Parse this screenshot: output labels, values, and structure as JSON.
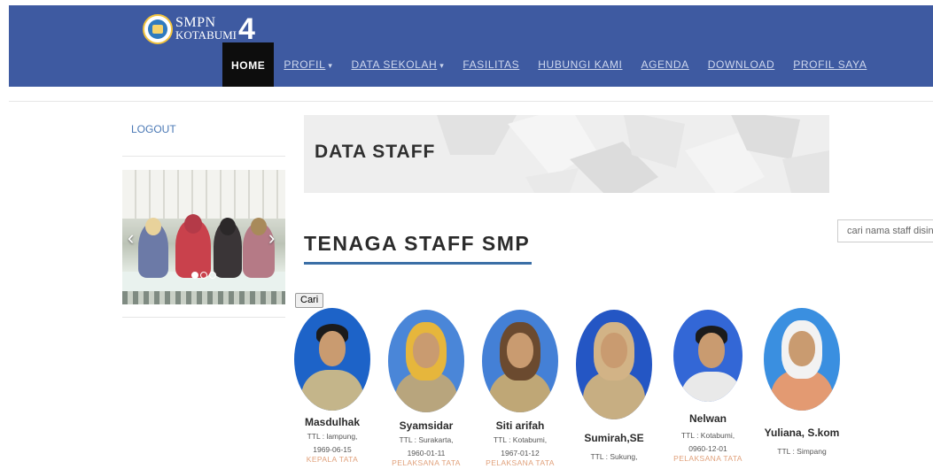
{
  "header": {
    "logo_line1": "SMPN",
    "logo_line2": "KOTABUMI",
    "logo_number": "4",
    "nav": [
      {
        "label": "HOME",
        "active": true,
        "dropdown": false
      },
      {
        "label": "PROFIL",
        "active": false,
        "dropdown": true
      },
      {
        "label": "DATA SEKOLAH",
        "active": false,
        "dropdown": true
      },
      {
        "label": "FASILITAS",
        "active": false,
        "dropdown": false
      },
      {
        "label": "HUBUNGI KAMI",
        "active": false,
        "dropdown": false
      },
      {
        "label": "AGENDA",
        "active": false,
        "dropdown": false
      },
      {
        "label": "DOWNLOAD",
        "active": false,
        "dropdown": false
      },
      {
        "label": "PROFIL SAYA",
        "active": false,
        "dropdown": false
      }
    ],
    "colors": {
      "bar": "#3e5aa1",
      "active": "#0d0d0d"
    }
  },
  "sidebar": {
    "logout_label": "LOGOUT",
    "carousel": {
      "prev_icon": "chevron-left-icon",
      "next_icon": "chevron-right-icon",
      "slides": 3,
      "active_slide": 1
    }
  },
  "main": {
    "banner_title": "DATA STAFF",
    "section_title": "TENAGA STAFF SMP",
    "search": {
      "placeholder": "cari nama staff disini..",
      "button_label": "Cari"
    },
    "accent_color": "#3b6fa6",
    "staff": [
      {
        "name": "Masdulhak",
        "ttl_1": "TTL : lampung,",
        "ttl_2": "1969-06-15",
        "role": "KEPALA TATA"
      },
      {
        "name": "Syamsidar",
        "ttl_1": "TTL : Surakarta,",
        "ttl_2": "1960-01-11",
        "role": "PELAKSANA TATA"
      },
      {
        "name": "Siti arifah",
        "ttl_1": "TTL : Kotabumi,",
        "ttl_2": "1967-01-12",
        "role": "PELAKSANA TATA"
      },
      {
        "name": "Sumirah,SE",
        "ttl_1": "TTL : Sukung,",
        "ttl_2": "",
        "role": ""
      },
      {
        "name": "Nelwan",
        "ttl_1": "TTL : Kotabumi,",
        "ttl_2": "0960-12-01",
        "role": "PELAKSANA TATA"
      },
      {
        "name": "Yuliana, S.kom",
        "ttl_1": "TTL : Simpang",
        "ttl_2": "",
        "role": ""
      }
    ]
  }
}
